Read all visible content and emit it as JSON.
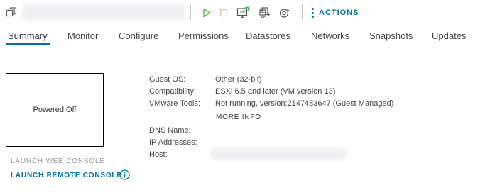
{
  "toolbar": {
    "actions_label": "ACTIONS",
    "icons": [
      "vm-icon",
      "power-on-icon",
      "power-off-icon",
      "launch-console-icon",
      "migrate-icon",
      "snapshot-icon"
    ],
    "colors": {
      "accent": "#0072a3",
      "power_on": "#41b04b",
      "power_off_disabled": "#f2b8b0"
    }
  },
  "tabs": [
    {
      "label": "Summary",
      "active": true
    },
    {
      "label": "Monitor"
    },
    {
      "label": "Configure"
    },
    {
      "label": "Permissions"
    },
    {
      "label": "Datastores"
    },
    {
      "label": "Networks"
    },
    {
      "label": "Snapshots"
    },
    {
      "label": "Updates"
    }
  ],
  "console": {
    "status": "Powered Off",
    "launch_web_console": "LAUNCH WEB CONSOLE",
    "launch_remote_console": "LAUNCH REMOTE CONSOLE"
  },
  "details": {
    "guest_os_label": "Guest OS:",
    "guest_os_value": "Other (32-bit)",
    "compatibility_label": "Compatibility:",
    "compatibility_value": "ESXi 6.5 and later (VM version 13)",
    "vmware_tools_label": "VMware Tools:",
    "vmware_tools_value": "Not running, version:2147483647 (Guest Managed)",
    "more_info": "MORE INFO",
    "dns_name_label": "DNS Name:",
    "ip_addresses_label": "IP Addresses:",
    "host_label": "Host:"
  }
}
